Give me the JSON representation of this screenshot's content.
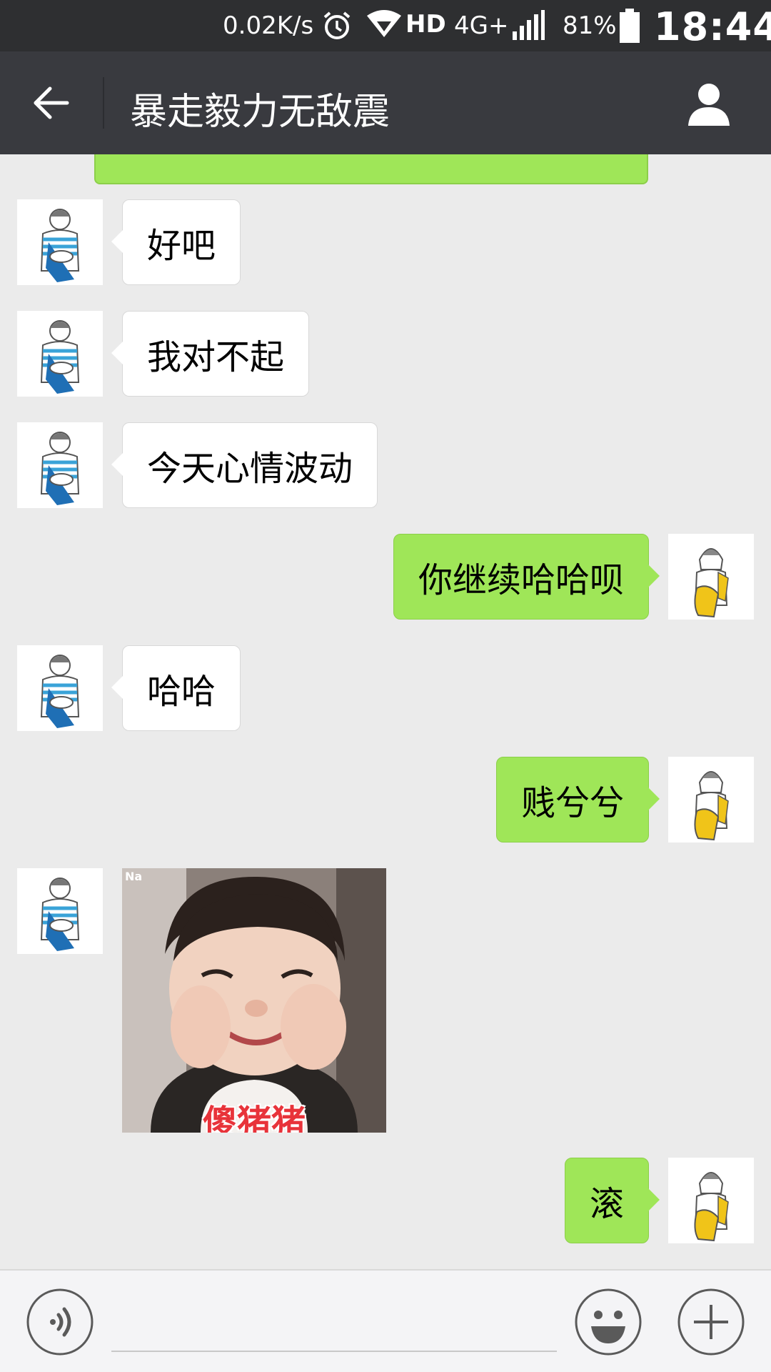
{
  "status_bar": {
    "speed": "0.02K/s",
    "hd": "HD",
    "network": "4G+",
    "battery": "81%",
    "time": "18:44"
  },
  "header": {
    "title": "暴走毅力无敌震"
  },
  "messages": [
    {
      "side": "left",
      "text": "好吧"
    },
    {
      "side": "left",
      "text": "我对不起"
    },
    {
      "side": "left",
      "text": "今天心情波动"
    },
    {
      "side": "right",
      "text": "你继续哈哈呗"
    },
    {
      "side": "left",
      "text": "哈哈"
    },
    {
      "side": "right",
      "text": "贱兮兮"
    },
    {
      "side": "left",
      "type": "sticker",
      "watermark": "Na",
      "caption": "傻猪猪"
    },
    {
      "side": "right",
      "text": "滚"
    }
  ],
  "colors": {
    "header_bg": "#393a3f",
    "status_bg": "#2e2f31",
    "chat_bg": "#ebebeb",
    "bubble_green": "#9fe658",
    "avatar_blue": "#1f6fb5",
    "avatar_yellow": "#f0c419"
  },
  "icons": {
    "back": "arrow-left-icon",
    "profile": "person-icon",
    "voice": "voice-icon",
    "emoji": "smiley-icon",
    "plus": "plus-icon"
  }
}
